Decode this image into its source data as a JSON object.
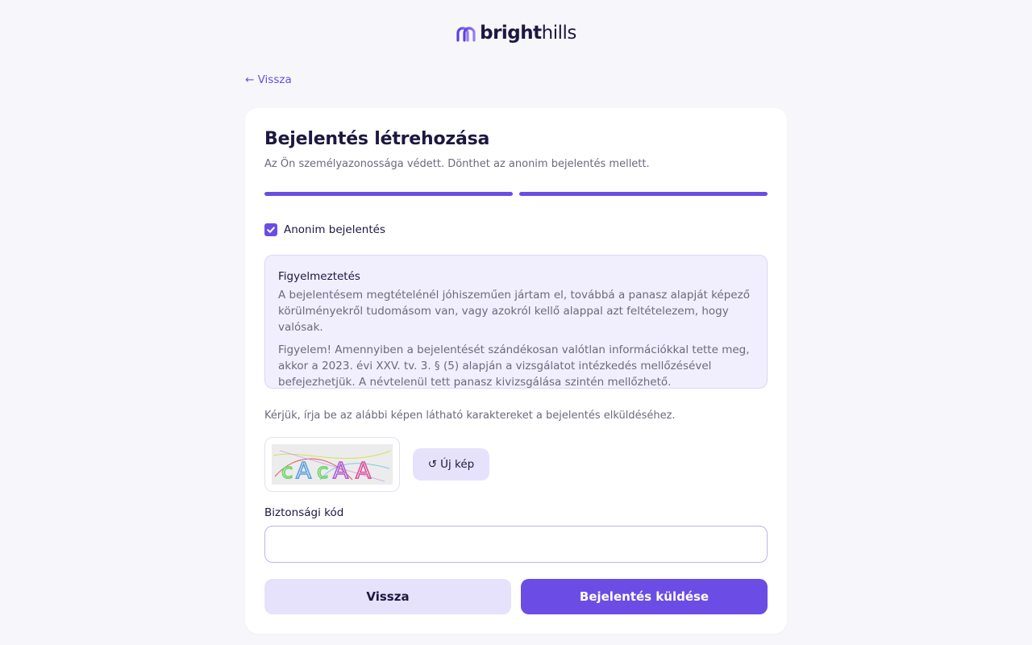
{
  "brand": {
    "logo_bold": "bright",
    "logo_rest": "hills",
    "icon": "brighthills-logo-icon",
    "accent_color": "#6b4de6"
  },
  "nav": {
    "back_link": "← Vissza"
  },
  "form": {
    "title": "Bejelentés létrehozása",
    "subtitle": "Az Ön személyazonossága védett. Dönthet az anonim bejelentés mellett.",
    "progress": {
      "total_steps": 2,
      "completed_steps": 2
    },
    "anonymous": {
      "label": "Anonim bejelentés",
      "checked": true
    },
    "warning": {
      "title": "Figyelmeztetés",
      "paragraph_1": "A bejelentésem megtételénél jóhiszeműen jártam el, továbbá a panasz alapját képező körülményekről tudomásom van, vagy azokról kellő alappal azt feltételezem, hogy valósak.",
      "paragraph_2": "Figyelem! Amennyiben a bejelentését szándékosan valótlan információkkal tette meg, akkor a 2023. évi XXV. tv. 3. § (5) alapján a vizsgálatot intézkedés mellőzésével befejezhetjük. A névtelenül tett panasz kivizsgálása szintén mellőzhető."
    },
    "captcha": {
      "hint": "Kérjük, írja be az alábbi képen látható karaktereket a bejelentés elküldéséhez.",
      "refresh_icon": "refresh-icon",
      "refresh_label": "Új kép",
      "image_text": "cAcAA"
    },
    "security_code": {
      "label": "Biztonsági kód",
      "value": "",
      "placeholder": ""
    },
    "buttons": {
      "back": "Vissza",
      "submit": "Bejelentés küldése"
    }
  }
}
